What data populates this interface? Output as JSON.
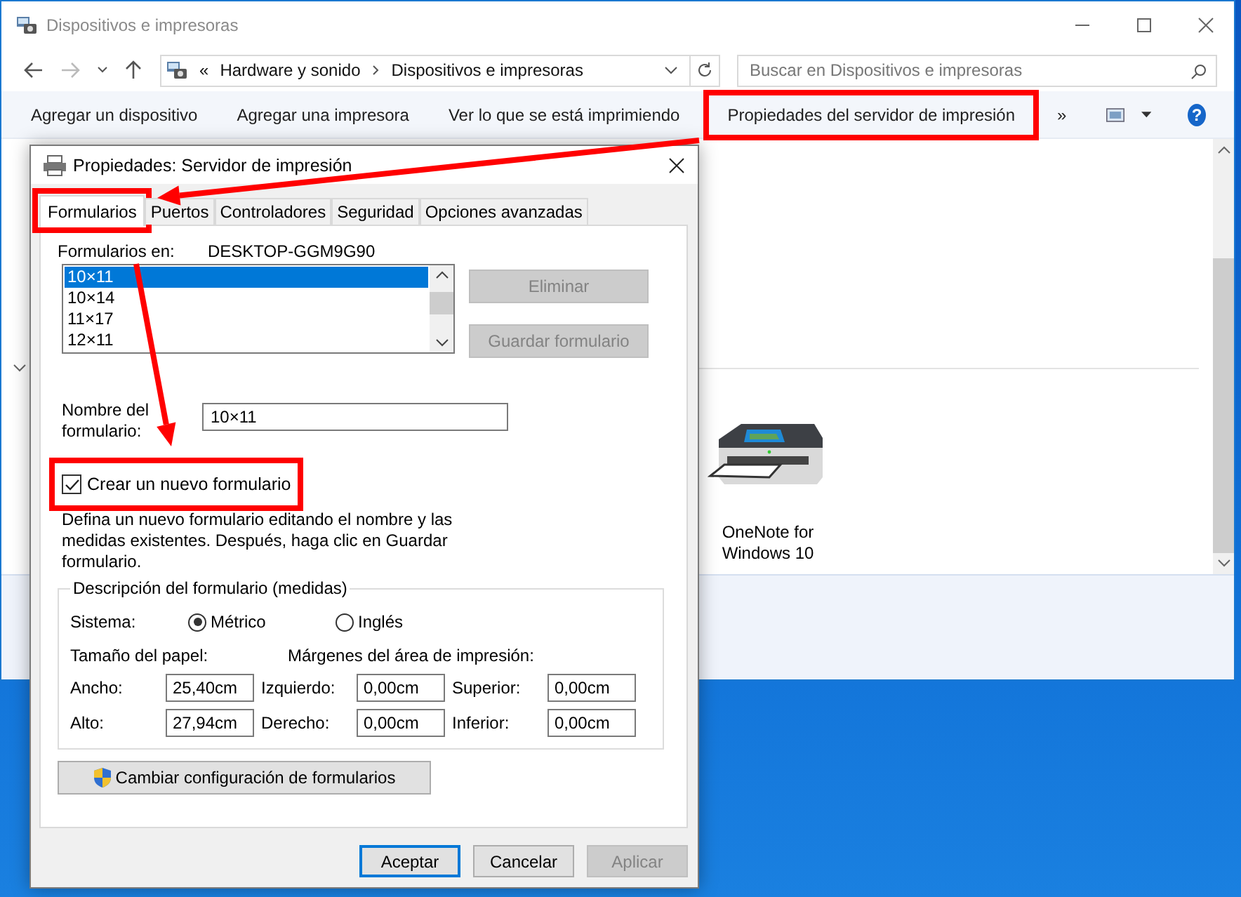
{
  "explorer": {
    "title": "Dispositivos e impresoras",
    "crumbs": [
      "Hardware y sonido",
      "Dispositivos e impresoras"
    ],
    "crumb_prefix": "«",
    "search": {
      "placeholder": "Buscar en Dispositivos e impresoras"
    },
    "commands": [
      {
        "label": "Agregar un dispositivo",
        "highlighted": false
      },
      {
        "label": "Agregar una impresora",
        "highlighted": false
      },
      {
        "label": "Ver lo que se está imprimiendo",
        "highlighted": false
      },
      {
        "label": "Propiedades del servidor de impresión",
        "highlighted": true
      }
    ],
    "more": "»",
    "help": "?",
    "devices": [
      {
        "label": "OneNote for Windows 10"
      }
    ]
  },
  "dialog": {
    "title": "Propiedades: Servidor de impresión",
    "tabs": [
      {
        "label": "Formularios",
        "selected": true,
        "highlighted": true
      },
      {
        "label": "Puertos",
        "selected": false,
        "highlighted": false
      },
      {
        "label": "Controladores",
        "selected": false,
        "highlighted": false
      },
      {
        "label": "Seguridad",
        "selected": false,
        "highlighted": false
      },
      {
        "label": "Opciones avanzadas",
        "selected": false,
        "highlighted": false
      }
    ],
    "forms_on_label": "Formularios en:",
    "server_name": "DESKTOP-GGM9G90",
    "forms": [
      {
        "label": "10×11",
        "selected": true
      },
      {
        "label": "10×14",
        "selected": false
      },
      {
        "label": "11×17",
        "selected": false
      },
      {
        "label": "12×11",
        "selected": false
      }
    ],
    "side_buttons": [
      {
        "label": "Eliminar",
        "disabled": true
      },
      {
        "label": "Guardar formulario",
        "disabled": true
      }
    ],
    "name_label": "Nombre del formulario:",
    "name_value": "10×11",
    "create_new": {
      "label": "Crear un nuevo formulario",
      "checked": true,
      "highlighted": true
    },
    "description": "Defina un nuevo formulario editando el nombre y las medidas existentes. Después, haga clic en Guardar formulario.",
    "group_legend": "Descripción del formulario (medidas)",
    "system_label": "Sistema:",
    "systems": [
      {
        "label": "Métrico",
        "selected": true
      },
      {
        "label": "Inglés",
        "selected": false
      }
    ],
    "paper_label": "Tamaño del papel:",
    "margins_label": "Márgenes del área de impresión:",
    "rows": [
      [
        {
          "label": "Ancho:",
          "value": "25,40cm"
        },
        {
          "label": "Izquierdo:",
          "value": "0,00cm"
        },
        {
          "label": "Superior:",
          "value": "0,00cm"
        }
      ],
      [
        {
          "label": "Alto:",
          "value": "27,94cm"
        },
        {
          "label": "Derecho:",
          "value": "0,00cm"
        },
        {
          "label": "Inferior:",
          "value": "0,00cm"
        }
      ]
    ],
    "change_button": "Cambiar configuración de formularios",
    "footer": [
      {
        "label": "Aceptar",
        "default": true,
        "disabled": false
      },
      {
        "label": "Cancelar",
        "default": false,
        "disabled": false
      },
      {
        "label": "Aplicar",
        "default": false,
        "disabled": true
      }
    ]
  }
}
